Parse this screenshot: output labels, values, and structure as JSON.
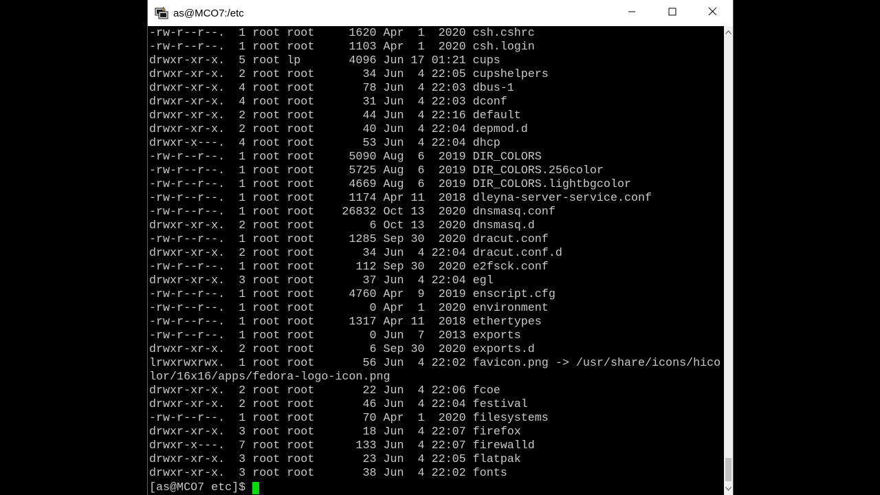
{
  "window": {
    "title": "as@MCO7:/etc",
    "icon": "putty-terminal-icon",
    "controls": [
      "minimize-icon",
      "maximize-icon",
      "close-icon"
    ]
  },
  "terminal": {
    "lines": [
      "-rw-r--r--.  1 root root     1620 Apr  1  2020 csh.cshrc",
      "-rw-r--r--.  1 root root     1103 Apr  1  2020 csh.login",
      "drwxr-xr-x.  5 root lp       4096 Jun 17 01:21 cups",
      "drwxr-xr-x.  2 root root       34 Jun  4 22:05 cupshelpers",
      "drwxr-xr-x.  4 root root       78 Jun  4 22:03 dbus-1",
      "drwxr-xr-x.  4 root root       31 Jun  4 22:03 dconf",
      "drwxr-xr-x.  2 root root       44 Jun  4 22:16 default",
      "drwxr-xr-x.  2 root root       40 Jun  4 22:04 depmod.d",
      "drwxr-x---.  4 root root       53 Jun  4 22:04 dhcp",
      "-rw-r--r--.  1 root root     5090 Aug  6  2019 DIR_COLORS",
      "-rw-r--r--.  1 root root     5725 Aug  6  2019 DIR_COLORS.256color",
      "-rw-r--r--.  1 root root     4669 Aug  6  2019 DIR_COLORS.lightbgcolor",
      "-rw-r--r--.  1 root root     1174 Apr 11  2018 dleyna-server-service.conf",
      "-rw-r--r--.  1 root root    26832 Oct 13  2020 dnsmasq.conf",
      "drwxr-xr-x.  2 root root        6 Oct 13  2020 dnsmasq.d",
      "-rw-r--r--.  1 root root     1285 Sep 30  2020 dracut.conf",
      "drwxr-xr-x.  2 root root       34 Jun  4 22:04 dracut.conf.d",
      "-rw-r--r--.  1 root root      112 Sep 30  2020 e2fsck.conf",
      "drwxr-xr-x.  3 root root       37 Jun  4 22:04 egl",
      "-rw-r--r--.  1 root root     4760 Apr  9  2019 enscript.cfg",
      "-rw-r--r--.  1 root root        0 Apr  1  2020 environment",
      "-rw-r--r--.  1 root root     1317 Apr 11  2018 ethertypes",
      "-rw-r--r--.  1 root root        0 Jun  7  2013 exports",
      "drwxr-xr-x.  2 root root        6 Sep 30  2020 exports.d",
      "lrwxrwxrwx.  1 root root       56 Jun  4 22:02 favicon.png -> /usr/share/icons/hico",
      "lor/16x16/apps/fedora-logo-icon.png",
      "drwxr-xr-x.  2 root root       22 Jun  4 22:06 fcoe",
      "drwxr-xr-x.  2 root root       46 Jun  4 22:04 festival",
      "-rw-r--r--.  1 root root       70 Apr  1  2020 filesystems",
      "drwxr-xr-x.  3 root root       18 Jun  4 22:07 firefox",
      "drwxr-x---.  7 root root      133 Jun  4 22:07 firewalld",
      "drwxr-xr-x.  3 root root       23 Jun  4 22:05 flatpak",
      "drwxr-xr-x.  3 root root       38 Jun  4 22:02 fonts"
    ],
    "prompt": "[as@MCO7 etc]$ "
  },
  "scrollbar": {
    "position_fraction": 0.97
  }
}
